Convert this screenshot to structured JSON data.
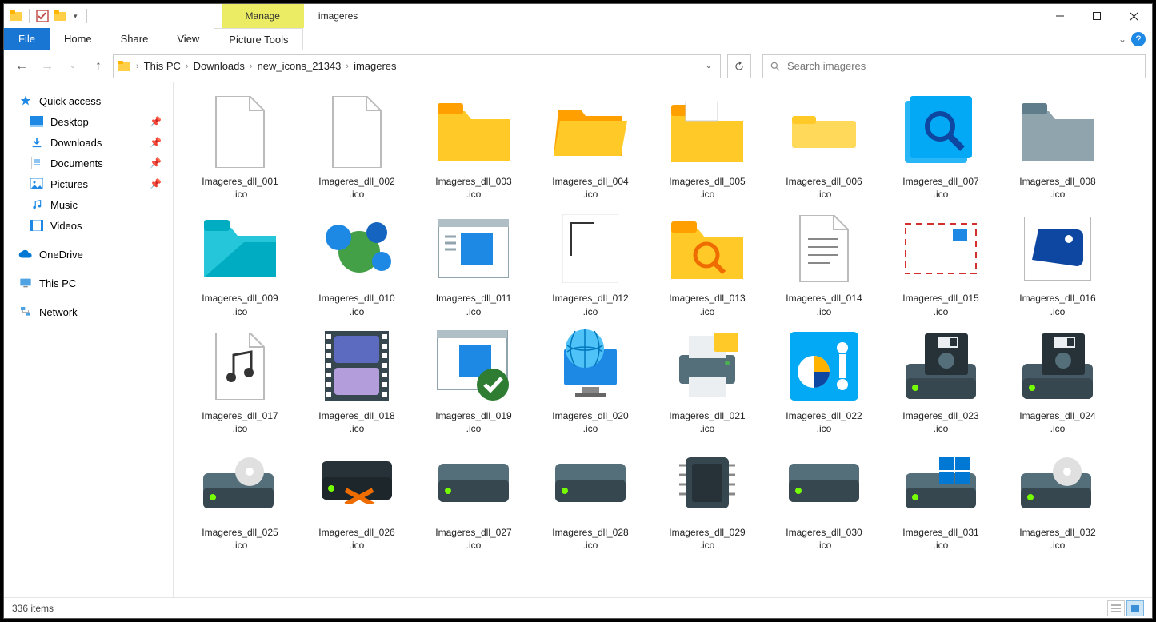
{
  "window": {
    "manage_label": "Manage",
    "title": "imageres"
  },
  "ribbon": {
    "file": "File",
    "tabs": [
      "Home",
      "Share",
      "View"
    ],
    "context_tab": "Picture Tools"
  },
  "breadcrumb": [
    "This PC",
    "Downloads",
    "new_icons_21343",
    "imageres"
  ],
  "search": {
    "placeholder": "Search imageres"
  },
  "sidebar": {
    "quick_access": "Quick access",
    "quick_items": [
      {
        "label": "Desktop",
        "icon": "desktop",
        "pinned": true
      },
      {
        "label": "Downloads",
        "icon": "downloads",
        "pinned": true
      },
      {
        "label": "Documents",
        "icon": "documents",
        "pinned": true
      },
      {
        "label": "Pictures",
        "icon": "pictures",
        "pinned": true
      },
      {
        "label": "Music",
        "icon": "music",
        "pinned": false
      },
      {
        "label": "Videos",
        "icon": "videos",
        "pinned": false
      }
    ],
    "onedrive": "OneDrive",
    "this_pc": "This PC",
    "network": "Network"
  },
  "files": [
    {
      "name": "Imageres_dll_001.ico",
      "icon": "file-blank"
    },
    {
      "name": "Imageres_dll_002.ico",
      "icon": "file-blank"
    },
    {
      "name": "Imageres_dll_003.ico",
      "icon": "folder-yellow"
    },
    {
      "name": "Imageres_dll_004.ico",
      "icon": "folder-open"
    },
    {
      "name": "Imageres_dll_005.ico",
      "icon": "folder-docs"
    },
    {
      "name": "Imageres_dll_006.ico",
      "icon": "folder-small"
    },
    {
      "name": "Imageres_dll_007.ico",
      "icon": "folder-search"
    },
    {
      "name": "Imageres_dll_008.ico",
      "icon": "folder-gray"
    },
    {
      "name": "Imageres_dll_009.ico",
      "icon": "folder-blue"
    },
    {
      "name": "Imageres_dll_010.ico",
      "icon": "homegroup"
    },
    {
      "name": "Imageres_dll_011.ico",
      "icon": "program-window"
    },
    {
      "name": "Imageres_dll_012.ico",
      "icon": "file-corner"
    },
    {
      "name": "Imageres_dll_013.ico",
      "icon": "folder-search-y"
    },
    {
      "name": "Imageres_dll_014.ico",
      "icon": "file-text"
    },
    {
      "name": "Imageres_dll_015.ico",
      "icon": "mail"
    },
    {
      "name": "Imageres_dll_016.ico",
      "icon": "picture"
    },
    {
      "name": "Imageres_dll_017.ico",
      "icon": "file-music"
    },
    {
      "name": "Imageres_dll_018.ico",
      "icon": "film"
    },
    {
      "name": "Imageres_dll_019.ico",
      "icon": "program-check"
    },
    {
      "name": "Imageres_dll_020.ico",
      "icon": "globe-monitor"
    },
    {
      "name": "Imageres_dll_021.ico",
      "icon": "printer"
    },
    {
      "name": "Imageres_dll_022.ico",
      "icon": "control-panel"
    },
    {
      "name": "Imageres_dll_023.ico",
      "icon": "floppy"
    },
    {
      "name": "Imageres_dll_024.ico",
      "icon": "floppy"
    },
    {
      "name": "Imageres_dll_025.ico",
      "icon": "drive-disc"
    },
    {
      "name": "Imageres_dll_026.ico",
      "icon": "drive-x"
    },
    {
      "name": "Imageres_dll_027.ico",
      "icon": "drive"
    },
    {
      "name": "Imageres_dll_028.ico",
      "icon": "drive"
    },
    {
      "name": "Imageres_dll_029.ico",
      "icon": "chip"
    },
    {
      "name": "Imageres_dll_030.ico",
      "icon": "drive"
    },
    {
      "name": "Imageres_dll_031.ico",
      "icon": "drive-win"
    },
    {
      "name": "Imageres_dll_032.ico",
      "icon": "drive-disc"
    }
  ],
  "status": {
    "count": "336 items"
  }
}
